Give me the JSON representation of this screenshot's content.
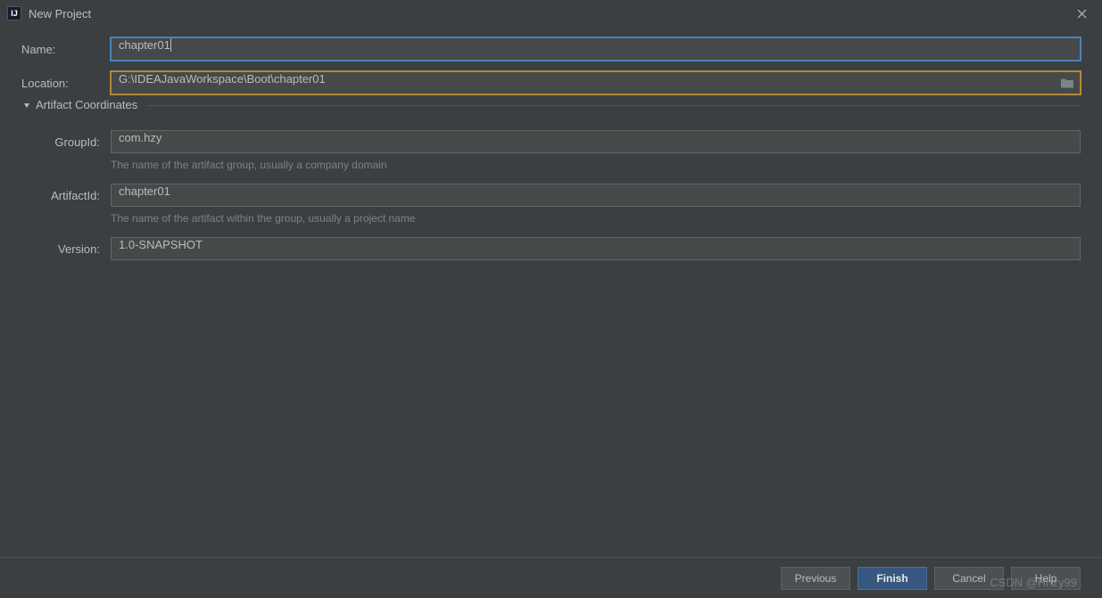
{
  "window": {
    "title": "New Project",
    "icon_label": "IJ"
  },
  "fields": {
    "name_label": "Name:",
    "name_value": "chapter01",
    "location_label": "Location:",
    "location_value": "G:\\IDEAJavaWorkspace\\Boot\\chapter01"
  },
  "section": {
    "title": "Artifact Coordinates",
    "group_id_label": "GroupId:",
    "group_id_value": "com.hzy",
    "group_id_hint": "The name of the artifact group, usually a company domain",
    "artifact_id_label": "ArtifactId:",
    "artifact_id_value": "chapter01",
    "artifact_id_hint": "The name of the artifact within the group, usually a project name",
    "version_label": "Version:",
    "version_value": "1.0-SNAPSHOT"
  },
  "buttons": {
    "previous": "Previous",
    "finish": "Finish",
    "cancel": "Cancel",
    "help": "Help"
  },
  "watermark": "CSDN @Hhzy99"
}
